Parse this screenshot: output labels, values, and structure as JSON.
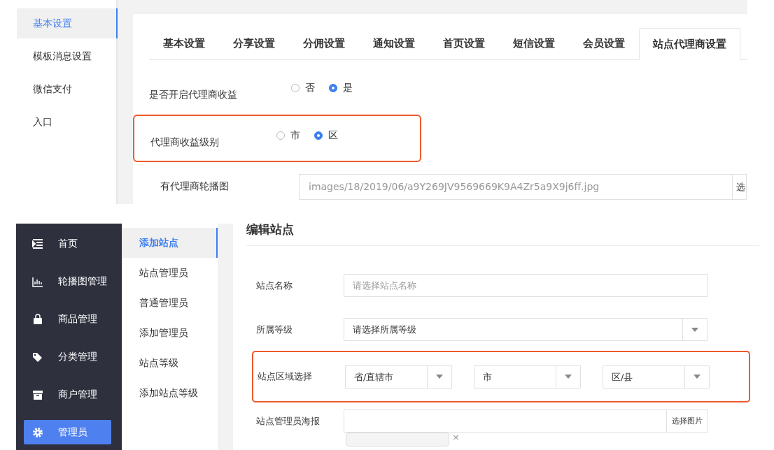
{
  "top_panel": {
    "side_menu": [
      {
        "label": "基本设置",
        "selected": true
      },
      {
        "label": "模板消息设置",
        "selected": false
      },
      {
        "label": "微信支付",
        "selected": false
      },
      {
        "label": "入口",
        "selected": false
      }
    ],
    "tabs": [
      {
        "label": "基本设置",
        "selected": false
      },
      {
        "label": "分享设置",
        "selected": false
      },
      {
        "label": "分佣设置",
        "selected": false
      },
      {
        "label": "通知设置",
        "selected": false
      },
      {
        "label": "首页设置",
        "selected": false
      },
      {
        "label": "短信设置",
        "selected": false
      },
      {
        "label": "会员设置",
        "selected": false
      },
      {
        "label": "站点代理商设置",
        "selected": true
      }
    ],
    "form": [
      {
        "kind": "radio",
        "label": "是否开启代理商收益",
        "highlighted": false,
        "options": [
          {
            "label": "否",
            "selected": false
          },
          {
            "label": "是",
            "selected": true
          }
        ]
      },
      {
        "kind": "radio",
        "label": "代理商收益级别",
        "highlighted": true,
        "options": [
          {
            "label": "市",
            "selected": false
          },
          {
            "label": "区",
            "selected": true
          }
        ]
      },
      {
        "kind": "file",
        "label": "有代理商轮播图",
        "highlighted": false,
        "value": "images/18/2019/06/a9Y269JV9569669K9A4Zr5a9X9j6ff.jpg",
        "button": "选"
      }
    ]
  },
  "bottom_panel": {
    "sidebar": [
      {
        "label": "首页",
        "selected": false
      },
      {
        "label": "轮播图管理",
        "selected": false
      },
      {
        "label": "商品管理",
        "selected": false
      },
      {
        "label": "分类管理",
        "selected": false
      },
      {
        "label": "商户管理",
        "selected": false
      },
      {
        "label": "管理员",
        "selected": true
      }
    ],
    "submenu": [
      {
        "label": "添加站点",
        "selected": true
      },
      {
        "label": "站点管理员",
        "selected": false
      },
      {
        "label": "普通管理员",
        "selected": false
      },
      {
        "label": "添加管理员",
        "selected": false
      },
      {
        "label": "站点等级",
        "selected": false
      },
      {
        "label": "添加站点等级",
        "selected": false
      }
    ],
    "title": "编辑站点",
    "form": [
      {
        "kind": "input",
        "label": "站点名称",
        "highlighted": false,
        "placeholder": "请选择站点名称"
      },
      {
        "kind": "select",
        "label": "所属等级",
        "highlighted": false,
        "selects": [
          "请选择所属等级"
        ]
      },
      {
        "kind": "select",
        "label": "站点区域选择",
        "highlighted": true,
        "selects": [
          "省/直辖市",
          "市",
          "区/县"
        ]
      },
      {
        "kind": "file",
        "label": "站点管理员海报",
        "highlighted": false,
        "button": "选择图片",
        "remove": "×"
      }
    ]
  }
}
